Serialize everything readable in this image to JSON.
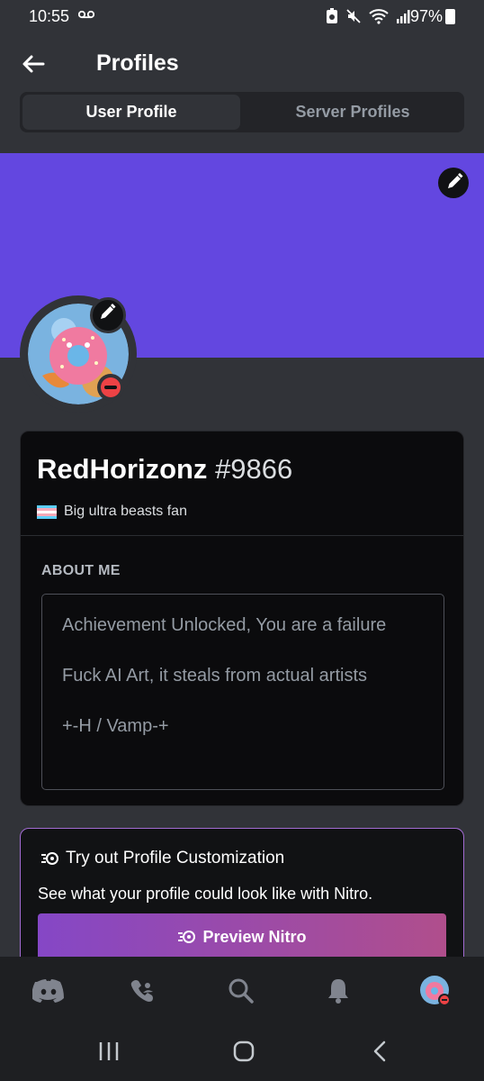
{
  "status_bar": {
    "time": "10:55",
    "battery": "97%"
  },
  "header": {
    "title": "Profiles"
  },
  "tabs": [
    {
      "label": "User Profile",
      "active": true
    },
    {
      "label": "Server Profiles",
      "active": false
    }
  ],
  "colors": {
    "banner": "#6347e0",
    "accent_gradient": [
      "#8547c6",
      "#b04e8c"
    ],
    "dnd_red": "#ed4245"
  },
  "profile": {
    "username": "RedHorizonz",
    "discriminator": "#9866",
    "custom_status": "Big ultra beasts fan",
    "status_icon": "trans-flag-icon",
    "presence": "do-not-disturb"
  },
  "about_me": {
    "label": "ABOUT ME",
    "lines": [
      "Achievement Unlocked, You are a failure",
      "Fuck AI Art, it steals from actual artists",
      "+-H / Vamp-+"
    ]
  },
  "nitro_promo": {
    "title": "Try out Profile Customization",
    "description": "See what your profile could look like with Nitro.",
    "button_label": "Preview Nitro"
  },
  "bottom_nav": [
    "discord-home-icon",
    "friends-icon",
    "search-icon",
    "notifications-icon",
    "you-avatar"
  ],
  "android_nav": [
    "recents-icon",
    "home-icon",
    "back-icon"
  ]
}
